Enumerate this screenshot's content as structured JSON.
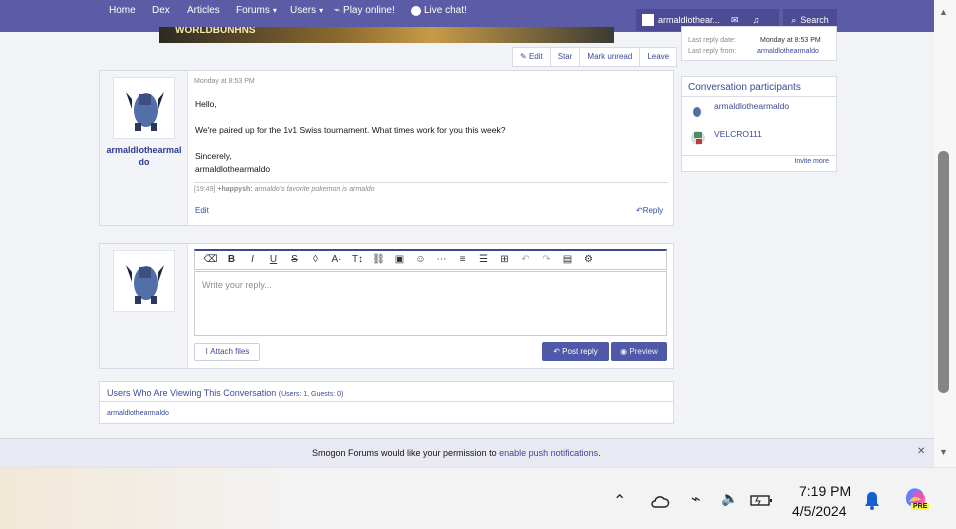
{
  "nav": {
    "items": [
      "Home",
      "Dex",
      "Articles",
      "Forums",
      "Users",
      "Play online!",
      "Live chat!"
    ],
    "username": "armaldlothear...",
    "search": "Search"
  },
  "thread": {
    "banner_text": "WORLDBUNHNS",
    "actions": [
      "Edit",
      "Star",
      "Mark unread",
      "Leave"
    ]
  },
  "post": {
    "username": "armaldlothearmaldo",
    "timestamp": "Monday at 8:53 PM",
    "lines": [
      "Hello,",
      "We're paired up for the 1v1 Swiss tournament. What times work for you this week?",
      "Sincerely,",
      "armaldlothearmaldo"
    ],
    "signature_time": "[19:49]",
    "signature_user": "+happysh:",
    "signature_text": "armaldo's favorite pokemon is armaldo",
    "edit": "Edit",
    "reply": "Reply"
  },
  "reply_box": {
    "placeholder": "Write your reply...",
    "attach": "Attach files",
    "post_reply": "Post reply",
    "preview": "Preview"
  },
  "viewing": {
    "title": "Users Who Are Viewing This Conversation",
    "counts": "(Users: 1, Guests: 0)",
    "user": "armaldlothearmaldo"
  },
  "sidebar": {
    "last_reply_date_label": "Last reply date:",
    "last_reply_date": "Monday at 8:53 PM",
    "last_reply_from_label": "Last reply from:",
    "last_reply_from": "armaldlothearmaldo",
    "participants_title": "Conversation participants",
    "participants": [
      "armaldlothearmaldo",
      "VELCRO111"
    ],
    "invite": "Invite more"
  },
  "push": {
    "before": "Smogon Forums would like your permission to",
    "link": "enable push notifications",
    "after": "."
  },
  "taskbar": {
    "time": "7:19 PM",
    "date": "4/5/2024",
    "copilot_badge": "PRE"
  },
  "colors": {
    "nav": "#5c5ba6",
    "link": "#3b4a96",
    "button": "#4f59a8"
  }
}
